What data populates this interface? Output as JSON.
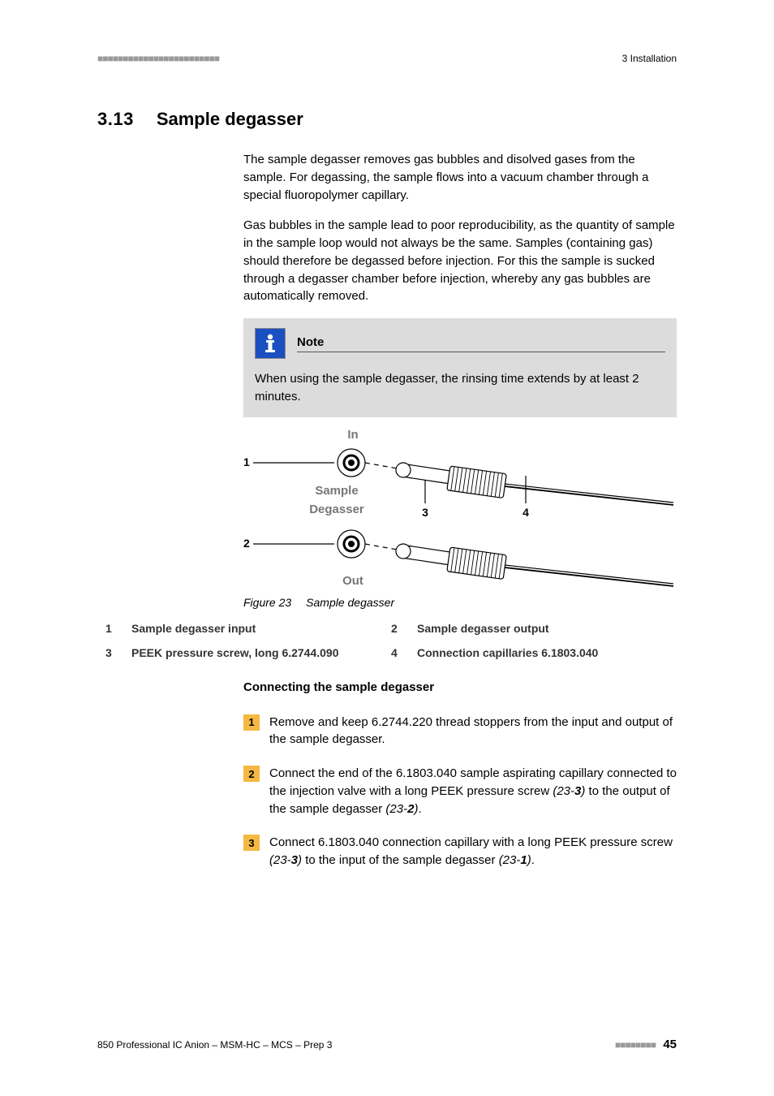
{
  "header": {
    "marks": "■■■■■■■■■■■■■■■■■■■■■■■■",
    "right": "3 Installation"
  },
  "section": {
    "num": "3.13",
    "title": "Sample degasser"
  },
  "para1": "The sample degasser removes gas bubbles and disolved gases from the sample. For degassing, the sample flows into a vacuum chamber through a special fluoropolymer capillary.",
  "para2": "Gas bubbles in the sample lead to poor reproducibility, as the quantity of sample in the sample loop would not always be the same. Samples (containing gas) should therefore be degassed before injection. For this the sample is sucked through a degasser chamber before injection, whereby any gas bubbles are automatically removed.",
  "note": {
    "title": "Note",
    "body": "When using the sample degasser, the rinsing time extends by at least 2 minutes."
  },
  "figure": {
    "labels": {
      "in": "In",
      "sample": "Sample",
      "degasser": "Degasser",
      "out": "Out",
      "n1": "1",
      "n2": "2",
      "n3": "3",
      "n4": "4"
    },
    "caption_num": "Figure 23",
    "caption_text": "Sample degasser"
  },
  "legend": {
    "r1c1n": "1",
    "r1c1t": "Sample degasser input",
    "r1c2n": "2",
    "r1c2t": "Sample degasser output",
    "r2c1n": "3",
    "r2c1t": "PEEK pressure screw, long 6.2744.090",
    "r2c2n": "4",
    "r2c2t": "Connection capillaries 6.1803.040"
  },
  "subhead": "Connecting the sample degasser",
  "steps": {
    "s1n": "1",
    "s1": "Remove and keep 6.2744.220 thread stoppers from the input and output of the sample degasser.",
    "s2n": "2",
    "s2a": "Connect the end of the 6.1803.040 sample aspirating capillary connected to the injection valve with a long PEEK pressure screw ",
    "s2r1p": "(23-",
    "s2r1b": "3",
    "s2r1s": ")",
    "s2b": " to the output of the sample degasser ",
    "s2r2p": "(23-",
    "s2r2b": "2",
    "s2r2s": ")",
    "s2c": ".",
    "s3n": "3",
    "s3a": "Connect 6.1803.040 connection capillary with a long PEEK pressure screw ",
    "s3r1p": "(23-",
    "s3r1b": "3",
    "s3r1s": ")",
    "s3b": " to the input of the sample degasser ",
    "s3r2p": "(23-",
    "s3r2b": "1",
    "s3r2s": ")",
    "s3c": "."
  },
  "footer": {
    "left": "850 Professional IC Anion – MSM-HC – MCS – Prep 3",
    "marks": "■■■■■■■■",
    "page": "45"
  }
}
